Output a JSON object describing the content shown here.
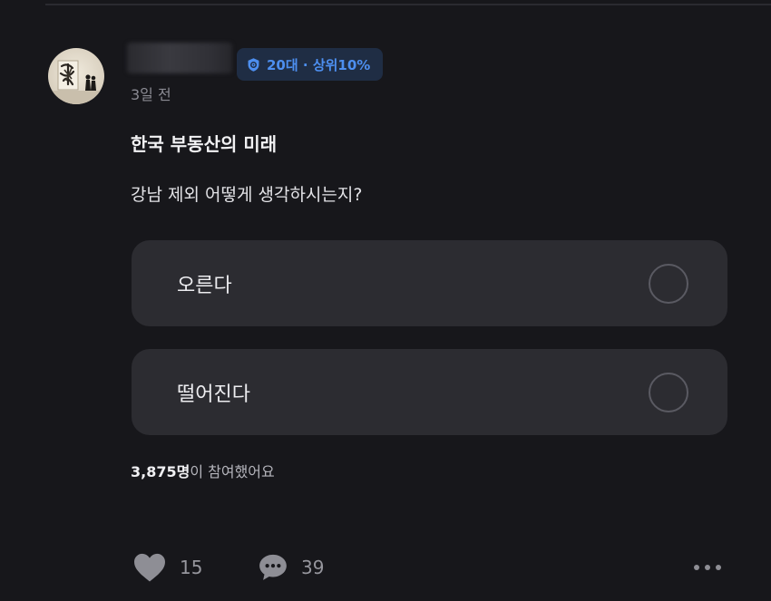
{
  "post": {
    "author_badge": "20대 · 상위10%",
    "time_ago": "3일 전",
    "title": "한국 부동산의 미래",
    "body": "강남 제외 어떻게 생각하시는지?"
  },
  "poll": {
    "options": [
      {
        "label": "오른다",
        "selected": false
      },
      {
        "label": "떨어진다",
        "selected": false
      }
    ],
    "participant_count": "3,875명",
    "participant_suffix": "이 참여했어요"
  },
  "actions": {
    "likes": "15",
    "comments": "39"
  },
  "icons": {
    "badge": "shield-icon",
    "like": "heart-icon",
    "comment": "speech-bubble-icon",
    "more": "more-dots-icon"
  },
  "colors": {
    "background": "#17171b",
    "card": "#2c2c31",
    "badge_background": "#1f2d44",
    "badge_text": "#4d8ff0",
    "muted_text": "#8a8a92"
  }
}
